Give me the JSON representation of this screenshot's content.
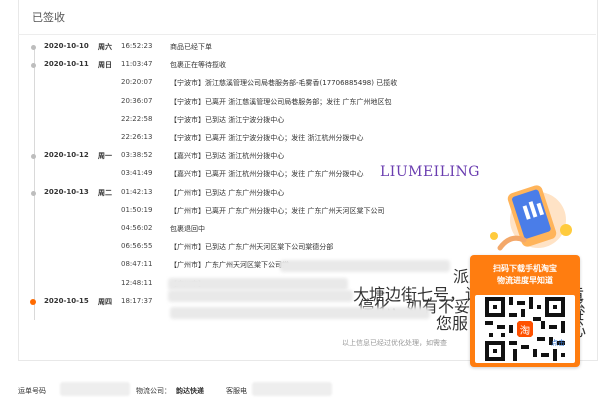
{
  "header": {
    "title": "已签收"
  },
  "tracking": [
    {
      "date": "2020-10-10",
      "day": "周六",
      "time": "16:52:23",
      "message": "商品已经下单"
    },
    {
      "date": "2020-10-11",
      "day": "周日",
      "time": "11:03:47",
      "message": "包裹正在等待揽收"
    },
    {
      "date": "",
      "day": "",
      "time": "20:20:07",
      "message": "【宁波市】浙江慈溪管理公司局巷服务部-毛雾香(17706885498) 已揽收"
    },
    {
      "date": "",
      "day": "",
      "time": "20:36:07",
      "message": "【宁波市】已离开 浙江慈溪管理公司局巷服务部；发往 广东广州地区包"
    },
    {
      "date": "",
      "day": "",
      "time": "22:22:58",
      "message": "【宁波市】已到达 浙江宁波分拨中心"
    },
    {
      "date": "",
      "day": "",
      "time": "22:26:13",
      "message": "【宁波市】已离开 浙江宁波分拨中心；发往 浙江杭州分拨中心"
    },
    {
      "date": "2020-10-12",
      "day": "周一",
      "time": "03:38:52",
      "message": "【嘉兴市】已到达 浙江杭州分拨中心"
    },
    {
      "date": "",
      "day": "",
      "time": "03:41:49",
      "message": "【嘉兴市】已离开 浙江杭州分拨中心；发往 广东广州分拨中心"
    },
    {
      "date": "2020-10-13",
      "day": "周二",
      "time": "01:42:13",
      "message": "【广州市】已到达 广东广州分拨中心"
    },
    {
      "date": "",
      "day": "",
      "time": "01:50:19",
      "message": "【广州市】已离开 广东广州分拨中心；发往 广东广州天河区棠下公司"
    },
    {
      "date": "",
      "day": "",
      "time": "04:56:02",
      "message": "包裹退回中"
    },
    {
      "date": "",
      "day": "",
      "time": "06:56:55",
      "message": "【广州市】已到达 广东广州天河区棠下公司棠德分部"
    },
    {
      "date": "",
      "day": "",
      "time": "08:47:11",
      "message": "【广州市】广东广州天河区棠下公司棠"
    },
    {
      "date": "",
      "day": "",
      "time": "12:48:11",
      "message": "【广州市】"
    },
    {
      "date": "2020-10-15",
      "day": "周四",
      "time": "18:17:37",
      "message": ""
    }
  ],
  "fragments": {
    "row12_tail": "派王",
    "row13_mid": "大塘边街七号，请及时领取，",
    "row13_tail": "黄洪",
    "row13b": "停化，如有不妥您见谅，好",
    "row13b_tail": "系心",
    "row14_tail": "您服"
  },
  "footnote": {
    "text": "以上信息已经过优化处理，如需查",
    "link": "点击"
  },
  "watermark": "LIUMEILING",
  "promo": {
    "line1": "扫码下载手机淘宝",
    "line2": "物流进度早知道",
    "badge": "淘"
  },
  "bottom": {
    "waybill_label": "运单号码",
    "carrier_label": "物流公司：",
    "carrier_name": "韵达快递",
    "service_label": "客服电"
  },
  "colors": {
    "accent": "#ff7d10",
    "last_dot": "#ff6a00",
    "link": "#3a7bd5",
    "watermark": "#6a3db0"
  }
}
